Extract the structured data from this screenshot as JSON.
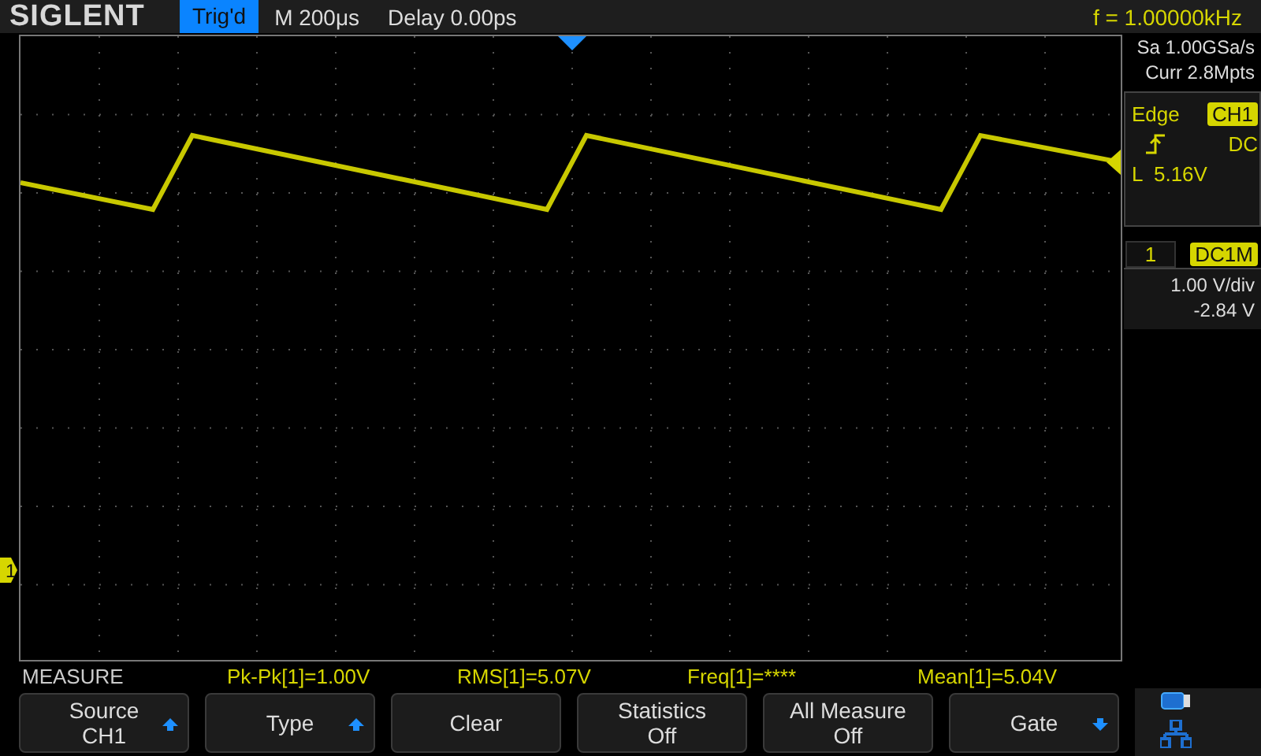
{
  "top_bar": {
    "brand": "SIGLENT",
    "trigger_status": "Trig'd",
    "timebase": "M 200μs",
    "delay": "Delay 0.00ps",
    "frequency": "f = 1.00000kHz"
  },
  "acquisition": {
    "sample_rate": "Sa 1.00GSa/s",
    "memory_depth": "Curr 2.8Mpts"
  },
  "trigger": {
    "type": "Edge",
    "source": "CH1",
    "coupling": "DC",
    "level": "L  5.16V"
  },
  "channel": {
    "number": "1",
    "coupling": "DC1M",
    "scale": "1.00 V/div",
    "offset": "-2.84 V"
  },
  "channel_marker": "1",
  "measure": {
    "title": "MEASURE",
    "readings": [
      "Pk-Pk[1]=1.00V",
      "RMS[1]=5.07V",
      "Freq[1]=****",
      "Mean[1]=5.04V"
    ]
  },
  "softkeys": [
    {
      "lines": [
        "Source",
        "CH1"
      ],
      "kind": "up"
    },
    {
      "lines": [
        "Type"
      ],
      "kind": "up"
    },
    {
      "lines": [
        "Clear"
      ],
      "kind": "plain"
    },
    {
      "lines": [
        "Statistics",
        "Off"
      ],
      "kind": "plain"
    },
    {
      "lines": [
        "All Measure",
        "Off"
      ],
      "kind": "plain"
    },
    {
      "lines": [
        "Gate"
      ],
      "kind": "down"
    }
  ]
}
